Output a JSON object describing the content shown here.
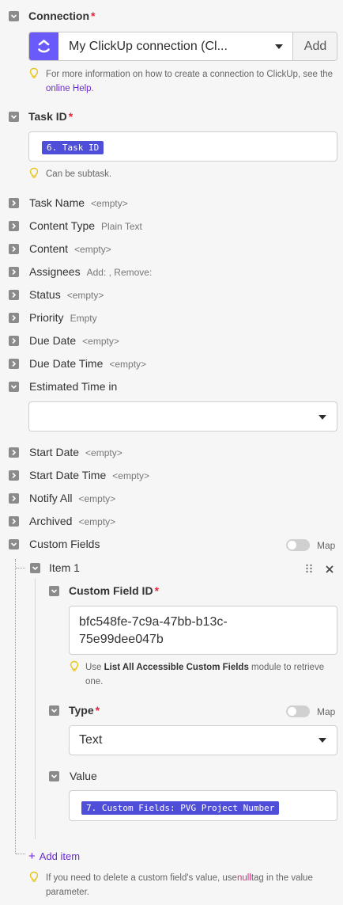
{
  "connection": {
    "label": "Connection",
    "value": "My ClickUp connection (Cl...",
    "add_label": "Add",
    "hint_text": "For more information on how to create a connection to ClickUp, see the ",
    "hint_link": "online Help",
    "hint_end": "."
  },
  "task_id": {
    "label": "Task ID",
    "pill": "6. Task ID",
    "hint": "Can be subtask."
  },
  "fields": [
    {
      "label": "Task Name",
      "value": "<empty>"
    },
    {
      "label": "Content Type",
      "value": "Plain Text"
    },
    {
      "label": "Content",
      "value": "<empty>"
    },
    {
      "label": "Assignees",
      "value": "Add: , Remove:"
    },
    {
      "label": "Status",
      "value": "<empty>"
    },
    {
      "label": "Priority",
      "value": "Empty"
    },
    {
      "label": "Due Date",
      "value": "<empty>"
    },
    {
      "label": "Due Date Time",
      "value": "<empty>"
    }
  ],
  "estimated_time": {
    "label": "Estimated Time in",
    "value": ""
  },
  "fields2": [
    {
      "label": "Start Date",
      "value": "<empty>"
    },
    {
      "label": "Start Date Time",
      "value": "<empty>"
    },
    {
      "label": "Notify All",
      "value": "<empty>"
    },
    {
      "label": "Archived",
      "value": "<empty>"
    }
  ],
  "custom_fields": {
    "label": "Custom Fields",
    "map_label": "Map",
    "item_label": "Item 1",
    "custom_field_id": {
      "label": "Custom Field ID",
      "value_line1": "bfc548fe-7c9a-47bb-b13c-",
      "value_line2": "75e99dee047b",
      "hint_pre": "Use ",
      "hint_bold": "List All Accessible Custom Fields",
      "hint_post": " module to retrieve one."
    },
    "type": {
      "label": "Type",
      "value": "Text",
      "map_label": "Map"
    },
    "value": {
      "label": "Value",
      "pill": "7. Custom Fields: PVG Project Number"
    },
    "add_item": "Add item",
    "hint_pre": "If you need to delete a custom field's value, use",
    "hint_null": "null",
    "hint_post": "tag in the value parameter."
  },
  "colors": {
    "accent": "#4f4ed8",
    "clickup_icon_bg": "#6a5af9",
    "required": "#e5243a",
    "link": "#6b2bd1"
  }
}
